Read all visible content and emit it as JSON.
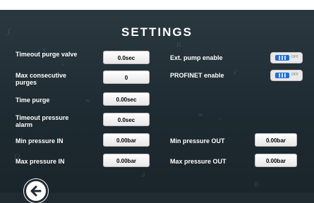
{
  "title": "SETTINGS",
  "left_settings": [
    {
      "label": "Timeout purge valve",
      "value": "0.0sec"
    },
    {
      "label": "Max consecutive purges",
      "value": "0"
    },
    {
      "label": "Time purge",
      "value": "0.00sec"
    },
    {
      "label": "Timeout pressure alarm",
      "value": "0.0sec"
    },
    {
      "label": "Min pressure IN",
      "value": "0.00bar"
    },
    {
      "label": "Max pressure IN",
      "value": "0.00bar"
    }
  ],
  "toggles": [
    {
      "label": "Ext. pump enable",
      "state": "OFF"
    },
    {
      "label": "PROFINET enable",
      "state": "OFF"
    }
  ],
  "right_settings": [
    {
      "label": "Min pressure OUT",
      "value": "0.00bar"
    },
    {
      "label": "Max pressure OUT",
      "value": "0.00bar"
    }
  ],
  "icons": {
    "back": "arrow-left-icon"
  },
  "colors": {
    "background": "#1f2a31",
    "toggle_accent": "#1e6fd9",
    "text": "#ffffff"
  }
}
